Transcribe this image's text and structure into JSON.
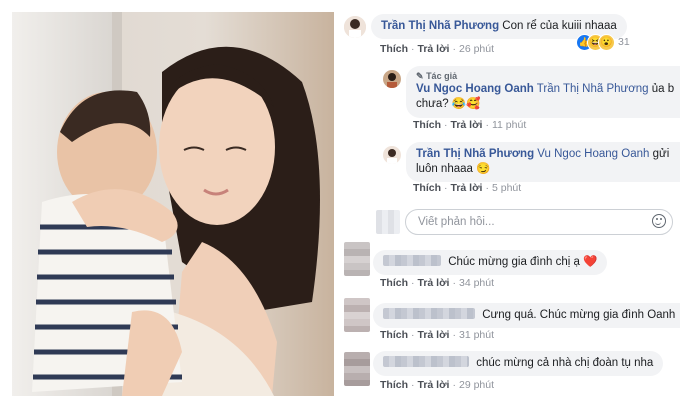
{
  "comments": [
    {
      "author": "Trần Thị Nhã Phương",
      "text": "Con rể của kuiii nhaaa",
      "actions": {
        "like": "Thích",
        "reply": "Trả lời",
        "time": "26 phút"
      },
      "reactions": {
        "icons": [
          "like-icon",
          "laugh-icon",
          "wow-icon"
        ],
        "count": "31"
      }
    },
    {
      "badge": "Tác giả",
      "author": "Vu Ngoc Hoang Oanh",
      "mention": "Trần Thị Nhã Phương",
      "text_line1": "ủa b",
      "text_line2": "chưa?",
      "emojis": [
        "😂",
        "🥰"
      ],
      "actions": {
        "like": "Thích",
        "reply": "Trả lời",
        "time": "11 phút"
      }
    },
    {
      "author": "Trần Thị Nhã Phương",
      "mention": "Vu Ngoc Hoang Oanh",
      "text_line1": "gửi",
      "text_line2": "luôn nhaaa",
      "emojis": [
        "😏"
      ],
      "actions": {
        "like": "Thích",
        "reply": "Trả lời",
        "time": "5 phút"
      }
    },
    {
      "text": "Chúc mừng gia đình chị ạ",
      "emojis": [
        "❤️"
      ],
      "actions": {
        "like": "Thích",
        "reply": "Trả lời",
        "time": "34 phút"
      }
    },
    {
      "text": "Cưng quá. Chúc mừng gia đình Oanh",
      "actions": {
        "like": "Thích",
        "reply": "Trả lời",
        "time": "31 phút"
      }
    },
    {
      "text": "chúc mừng cả nhà chị đoàn tụ nha",
      "actions": {
        "like": "Thích",
        "reply": "Trả lời",
        "time": "29 phút"
      }
    }
  ],
  "reply_box": {
    "placeholder": "Viết phản hồi...",
    "emoji_icon": "smiley-icon"
  },
  "photo": {
    "icon": "photo-mother-baby"
  }
}
